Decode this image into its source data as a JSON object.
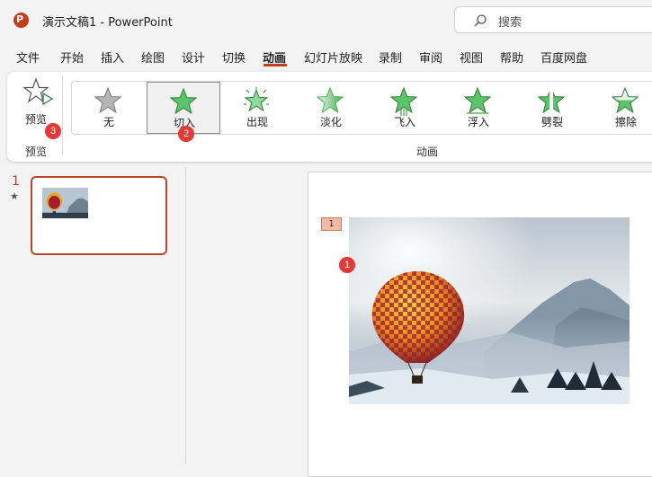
{
  "titlebar": {
    "app_icon_letter": "P",
    "document_title": "演示文稿1  -  PowerPoint",
    "search_placeholder": "搜索"
  },
  "menu": {
    "items": [
      "文件",
      "开始",
      "插入",
      "绘图",
      "设计",
      "切换",
      "动画",
      "幻灯片放映",
      "录制",
      "审阅",
      "视图",
      "帮助",
      "百度网盘"
    ],
    "active": "动画"
  },
  "ribbon": {
    "preview_label": "预览",
    "preview_group_label": "预览",
    "animation_group_label": "动画",
    "effects": [
      {
        "label": "无",
        "icon": "star-gray-icon"
      },
      {
        "label": "切入",
        "icon": "star-green-icon",
        "selected": true
      },
      {
        "label": "出现",
        "icon": "star-burst-icon"
      },
      {
        "label": "淡化",
        "icon": "star-fade-icon"
      },
      {
        "label": "飞入",
        "icon": "star-fly-icon"
      },
      {
        "label": "浮入",
        "icon": "star-float-icon"
      },
      {
        "label": "劈裂",
        "icon": "star-split-icon"
      },
      {
        "label": "擦除",
        "icon": "star-wipe-icon"
      }
    ]
  },
  "badges": {
    "b1": "1",
    "b2": "2",
    "b3": "3"
  },
  "slides_pane": {
    "slide_number": "1",
    "animation_indicator": "★"
  },
  "slide": {
    "animation_tag": "1",
    "image_subject": "hot-air-balloon"
  },
  "colors": {
    "accent": "#c43e1c",
    "badge": "#e53935",
    "star_green": "#4caf50"
  }
}
